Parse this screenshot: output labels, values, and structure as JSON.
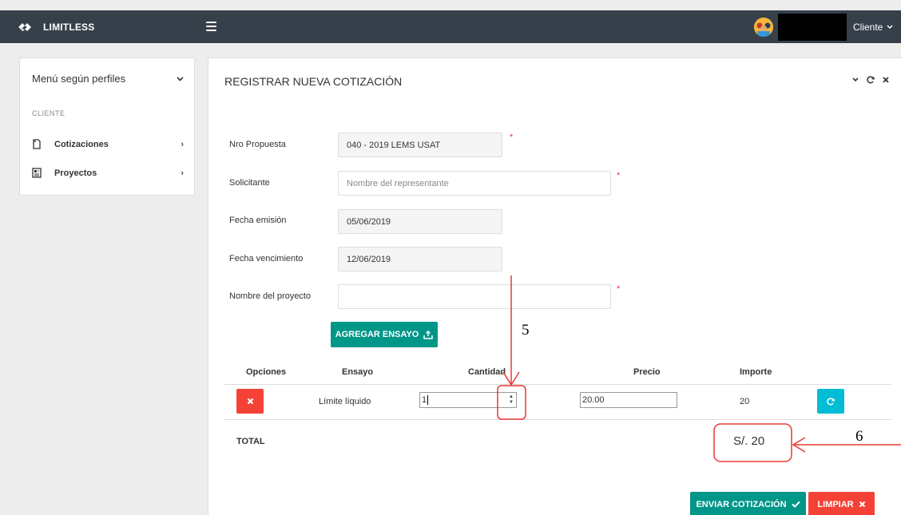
{
  "navbar": {
    "brand": "LIMITLESS",
    "user_menu": "Cliente"
  },
  "sidebar": {
    "header": "Menú según perfiles",
    "category": "CLIENTE",
    "items": [
      {
        "label": "Cotizaciones",
        "icon": "file-icon"
      },
      {
        "label": "Proyectos",
        "icon": "newspaper-icon"
      }
    ]
  },
  "panel": {
    "title": "REGISTRAR NUEVA COTIZACIÓN"
  },
  "form": {
    "nro_propuesta": {
      "label": "Nro Propuesta",
      "value": "040 - 2019 LEMS USAT"
    },
    "solicitante": {
      "label": "Solicitante",
      "placeholder": "Nombre del representante"
    },
    "fecha_emision": {
      "label": "Fecha emisión",
      "value": "05/06/2019"
    },
    "fecha_vencimiento": {
      "label": "Fecha vencimiento",
      "value": "12/06/2019"
    },
    "nombre_proyecto": {
      "label": "Nombre del proyecto",
      "value": ""
    },
    "required_mark": "*",
    "add_button": "AGREGAR ENSAYO"
  },
  "table": {
    "headers": [
      "Opciones",
      "Ensayo",
      "Cantidad",
      "Precio",
      "Importe"
    ],
    "rows": [
      {
        "ensayo": "Límite líquido",
        "cantidad": "1",
        "precio": "20.00",
        "importe": "20"
      }
    ]
  },
  "total": {
    "label": "TOTAL",
    "value": "S/. 20"
  },
  "actions": {
    "send": "ENVIAR COTIZACIÓN",
    "clear": "LIMPIAR"
  },
  "annotations": {
    "label_5": "5",
    "label_6": "6",
    "color": "#e53935"
  },
  "colors": {
    "navbar": "#36404b",
    "teal": "#009688",
    "red": "#f44336",
    "cyan": "#00bcd4"
  }
}
